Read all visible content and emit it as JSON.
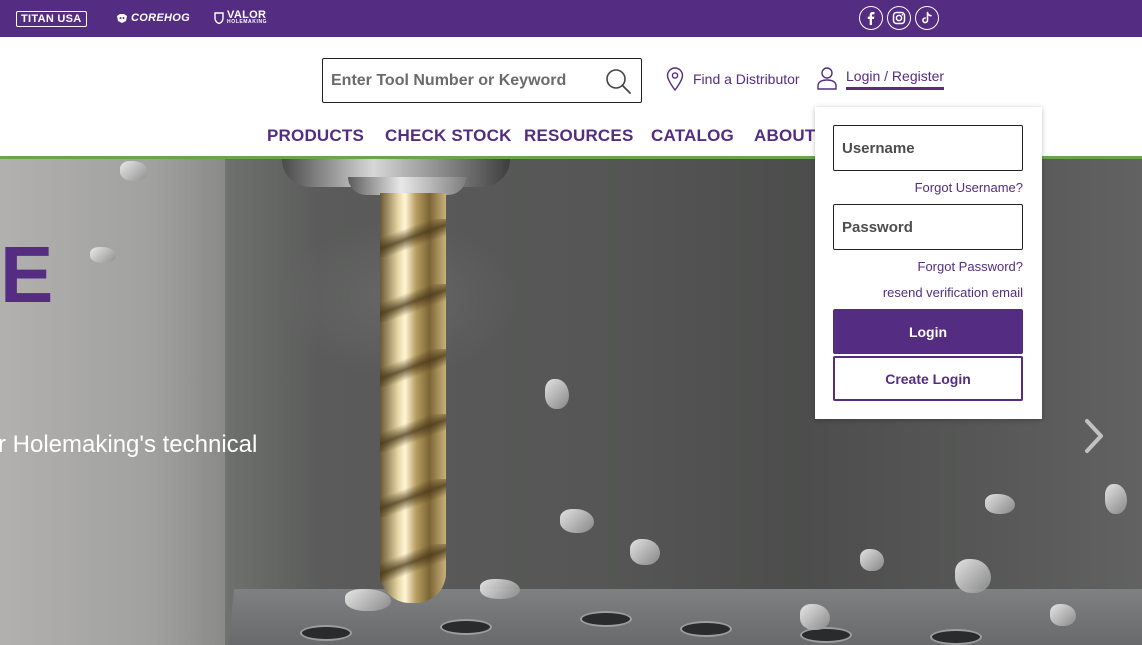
{
  "topbar": {
    "brands": [
      "TITAN USA",
      "COREHOG",
      "VALOR",
      "HOLEMAKING"
    ],
    "social": [
      "facebook-icon",
      "instagram-icon",
      "tiktok-icon"
    ]
  },
  "header": {
    "search_placeholder": "Enter Tool Number or Keyword",
    "find_distributor": "Find a Distributor",
    "login_register": "Login / Register"
  },
  "nav": {
    "items": [
      "PRODUCTS",
      "CHECK STOCK",
      "RESOURCES",
      "CATALOG",
      "ABOUT U"
    ]
  },
  "hero": {
    "headline_fragment": "E",
    "subtext_fragment": "r Holemaking's technical"
  },
  "login_dropdown": {
    "username_placeholder": "Username",
    "forgot_username": "Forgot Username?",
    "password_placeholder": "Password",
    "forgot_password": "Forgot Password?",
    "resend_verification": "resend verification email",
    "login_button": "Login",
    "create_login_button": "Create Login"
  },
  "colors": {
    "brand_purple": "#542d82",
    "accent_green": "#6da34d"
  }
}
